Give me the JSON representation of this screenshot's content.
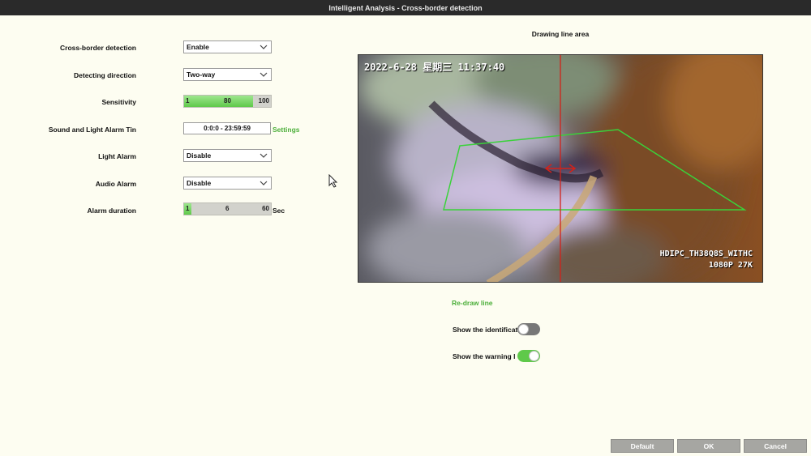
{
  "window": {
    "title": "Intelligent Analysis - Cross-border detection"
  },
  "form": {
    "cross_border_label": "Cross-border detection",
    "cross_border_value": "Enable",
    "direction_label": "Detecting direction",
    "direction_value": "Two-way",
    "sensitivity_label": "Sensitivity",
    "sensitivity": {
      "min": "1",
      "value": "80",
      "max": "100",
      "level": 80
    },
    "alarm_time_label": "Sound and Light Alarm Tin",
    "alarm_time_value": "0:0:0 - 23:59:59",
    "settings_link": "Settings",
    "light_alarm_label": "Light Alarm",
    "light_alarm_value": "Disable",
    "audio_alarm_label": "Audio Alarm",
    "audio_alarm_value": "Disable",
    "duration_label": "Alarm duration",
    "duration": {
      "min": "1",
      "value": "6",
      "max": "60",
      "unit": "Sec",
      "level": 6
    }
  },
  "preview": {
    "heading": "Drawing line area",
    "timestamp": "2022-6-28 星期三 11:37:40",
    "camera_name": "HDIPC_TH38Q8S_WITHC",
    "resolution": "1080P 27K",
    "redraw_link": "Re-draw line",
    "show_identification_label": "Show the identificat",
    "show_identification_on": false,
    "show_warning_label": "Show the warning l",
    "show_warning_on": true
  },
  "footer": {
    "default_label": "Default",
    "ok_label": "OK",
    "cancel_label": "Cancel"
  },
  "colors": {
    "accent_green": "#5fc94a",
    "title_bg": "#2a2a2a",
    "button_grey": "#a6a6a2",
    "toggle_off": "#777777"
  }
}
